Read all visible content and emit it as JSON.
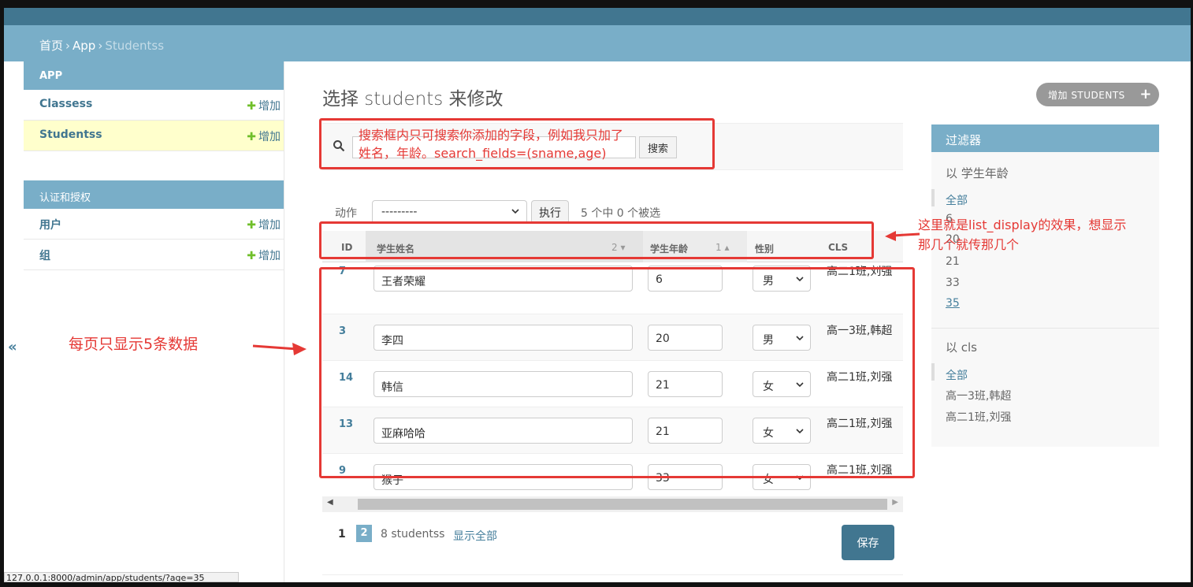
{
  "breadcrumb": {
    "home": "首页",
    "app": "App",
    "current": "Studentss",
    "sep": "›"
  },
  "sidebar": {
    "modules": [
      {
        "caption": "APP",
        "items": [
          {
            "label": "Classess",
            "add": "增加"
          },
          {
            "label": "Studentss",
            "add": "增加"
          }
        ]
      },
      {
        "caption": "认证和授权",
        "items": [
          {
            "label": "用户",
            "add": "增加"
          },
          {
            "label": "组",
            "add": "增加"
          }
        ]
      }
    ],
    "collapse": "«"
  },
  "page": {
    "title": "选择 students 来修改",
    "add_button": "增加 STUDENTS"
  },
  "search": {
    "button": "搜索"
  },
  "actions": {
    "label": "动作",
    "select_value": "---------",
    "go": "执行",
    "count": "5 个中 0 个被选"
  },
  "table": {
    "headers": {
      "id": "ID",
      "name": "学生姓名",
      "name_sort": "2",
      "age": "学生年龄",
      "age_sort": "1",
      "sex": "性别",
      "cls": "CLS"
    },
    "rows": [
      {
        "id": "7",
        "name": "王者荣耀",
        "age": "6",
        "sex": "男",
        "cls": "高二1班,刘强"
      },
      {
        "id": "3",
        "name": "李四",
        "age": "20",
        "sex": "男",
        "cls": "高一3班,韩超"
      },
      {
        "id": "14",
        "name": "韩信",
        "age": "21",
        "sex": "女",
        "cls": "高二1班,刘强"
      },
      {
        "id": "13",
        "name": "亚麻哈哈",
        "age": "21",
        "sex": "女",
        "cls": "高二1班,刘强"
      },
      {
        "id": "9",
        "name": "猴子",
        "age": "33",
        "sex": "女",
        "cls": "高二1班,刘强"
      }
    ]
  },
  "paginator": {
    "page1": "1",
    "page2": "2",
    "total": "8 studentss",
    "show_all": "显示全部",
    "save": "保存"
  },
  "filter": {
    "caption": "过滤器",
    "age_title": "以 学生年龄",
    "age_options": [
      "全部",
      "6",
      "20",
      "21",
      "33",
      "35"
    ],
    "cls_title": "以 cls",
    "cls_options": [
      "全部",
      "高一3班,韩超",
      "高二1班,刘强"
    ]
  },
  "status_url": "127.0.0.1:8000/admin/app/students/?age=35",
  "annotations": {
    "search_note_1": "搜索框内只可搜索你添加的字段，例如我只加了",
    "search_note_2": "姓名，年龄。search_fields=(sname,age)",
    "list_display_note_1": "这里就是list_display的效果，想显示",
    "list_display_note_2": "那几个就传那几个",
    "per_page_note": "每页只显示5条数据"
  },
  "colors": {
    "header": "#417690",
    "breadcrumb": "#79aec8",
    "annotation": "#e53935",
    "add_plus": "#70bf2b"
  }
}
